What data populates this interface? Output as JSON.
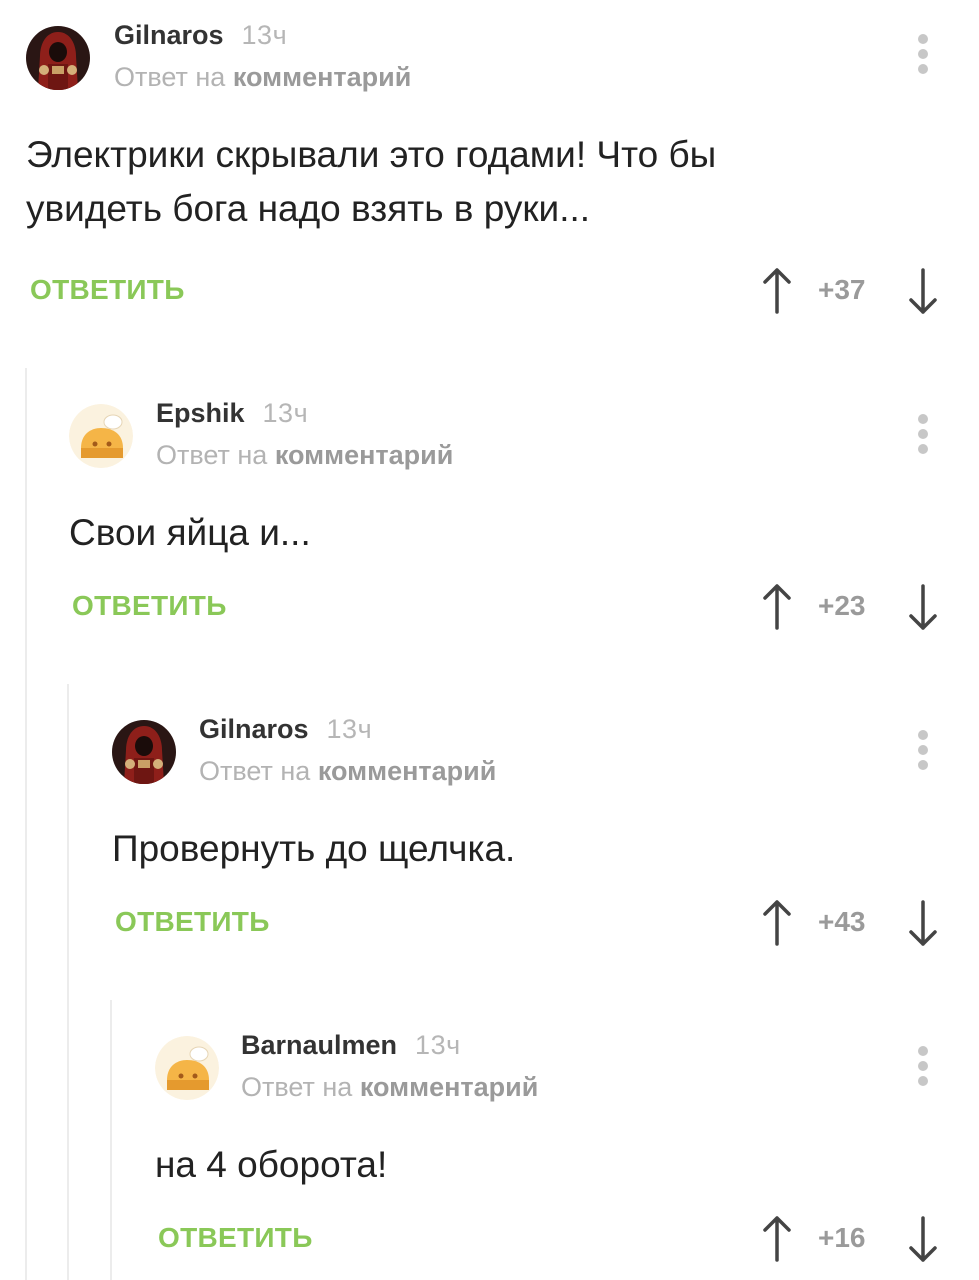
{
  "reply_prefix": "Ответ на",
  "reply_target": "комментарий",
  "reply_label": "ОТВЕТИТЬ",
  "colors": {
    "accent_green": "#8ac858",
    "muted_gray": "#b3b3b3",
    "thread_line": "#ececec"
  },
  "comments": [
    {
      "author": "Gilnaros",
      "time": "13ч",
      "avatar": "hooded-warrior-avatar",
      "text_line1": "Электрики скрывали это годами! Что бы",
      "text_line2": "увидеть бога надо взять в руки...",
      "score": "+37"
    },
    {
      "author": "Epshik",
      "time": "13ч",
      "avatar": "default-cake-avatar",
      "text_line1": "Свои яйца и...",
      "score": "+23"
    },
    {
      "author": "Gilnaros",
      "time": "13ч",
      "avatar": "hooded-warrior-avatar",
      "text_line1": "Провернуть до щелчка.",
      "score": "+43"
    },
    {
      "author": "Barnaulmen",
      "time": "13ч",
      "avatar": "default-cake-avatar",
      "text_line1": "на 4 оборота!",
      "score": "+16"
    }
  ]
}
